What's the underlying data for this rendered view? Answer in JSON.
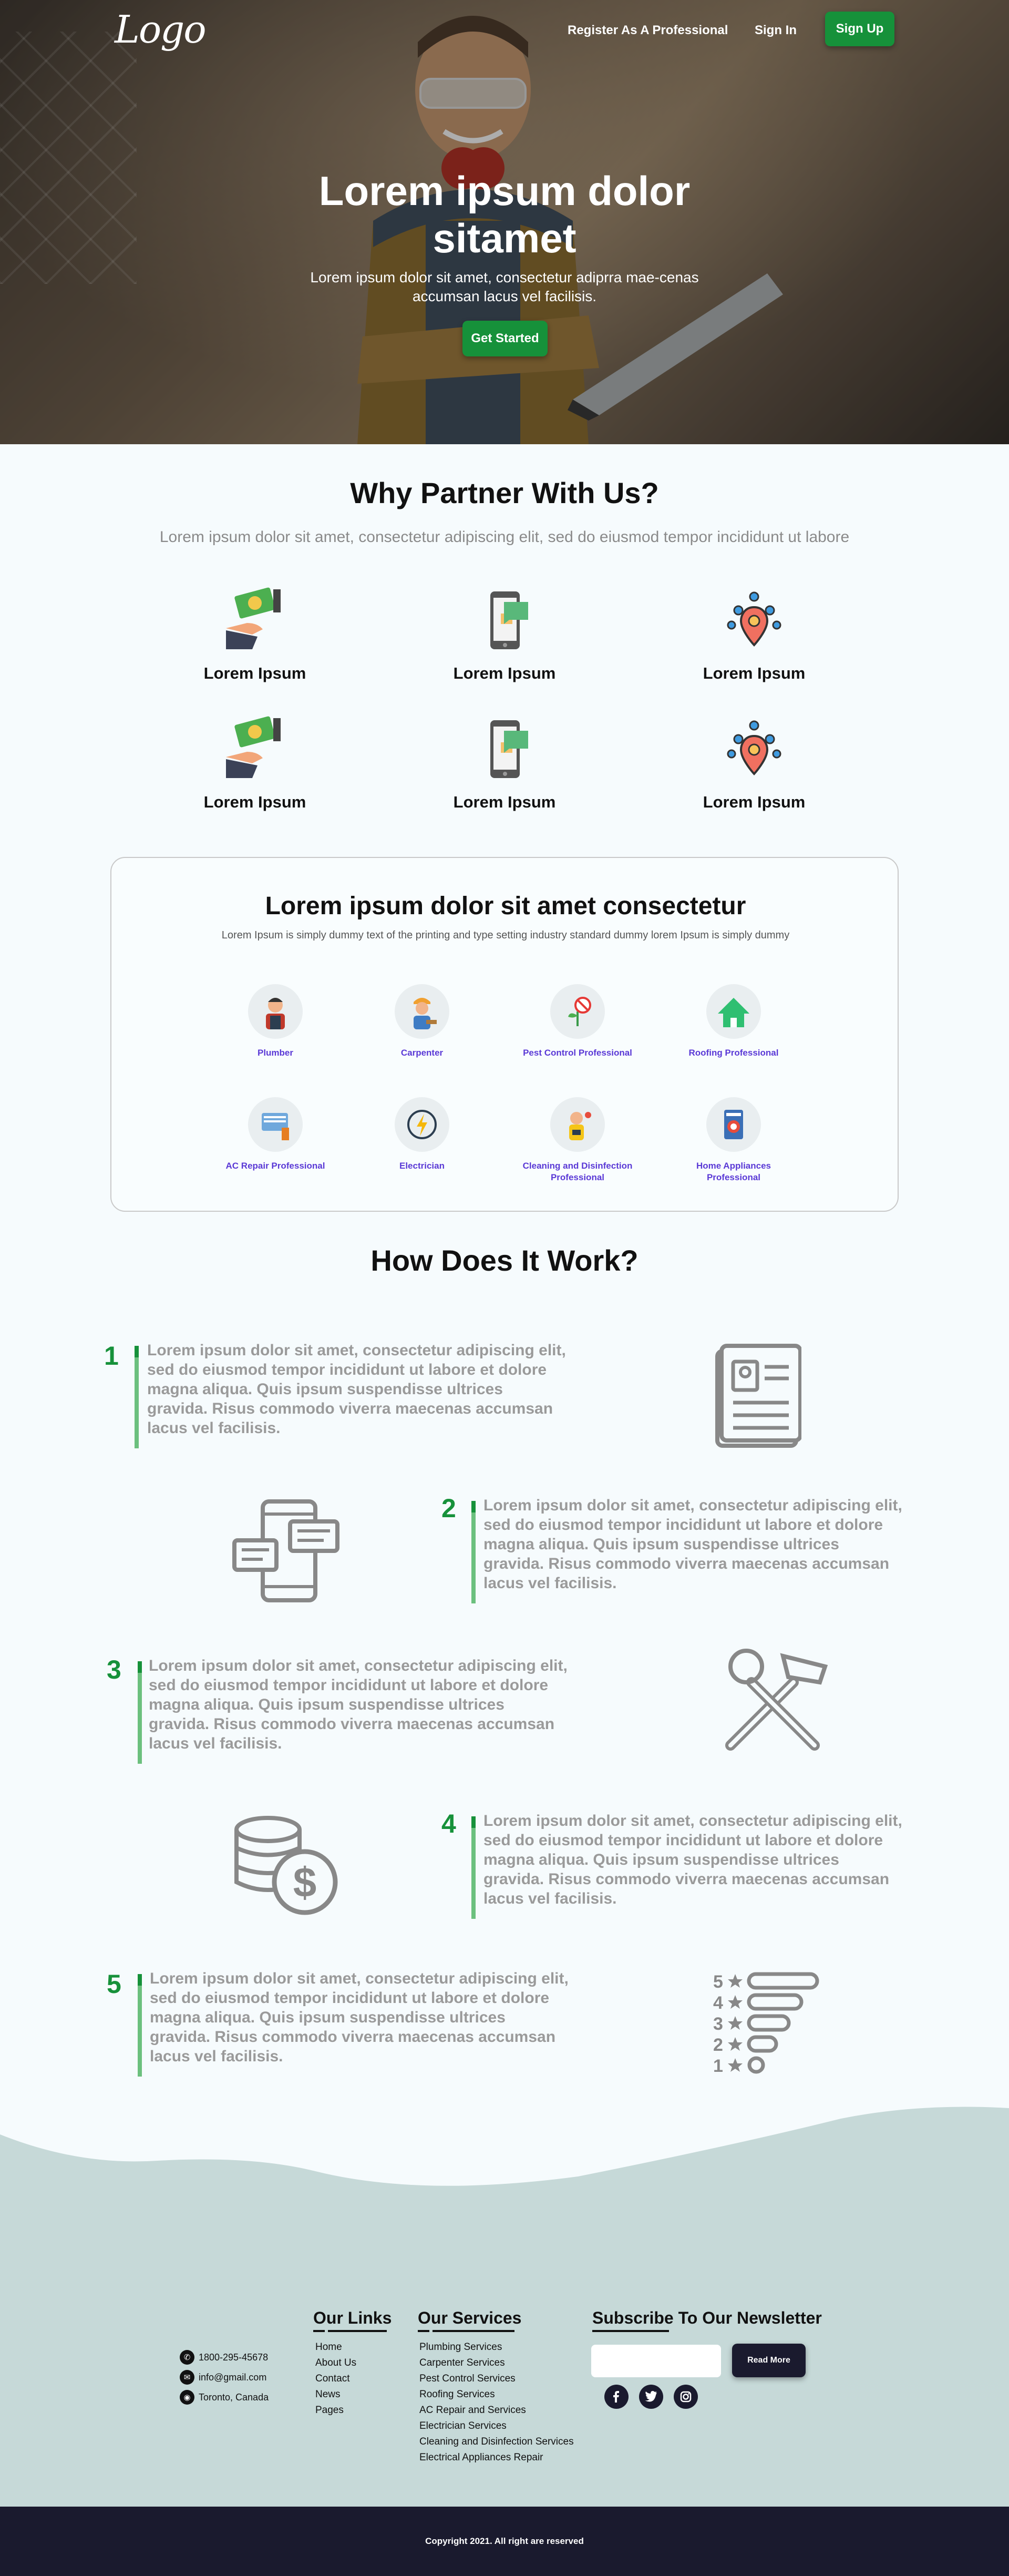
{
  "nav": {
    "logo": "Logo",
    "register": "Register As A Professional",
    "signin": "Sign In",
    "signup": "Sign Up"
  },
  "hero": {
    "title": "Lorem ipsum dolor sitamet",
    "subtitle": "Lorem ipsum dolor sit amet, consectetur adiprra mae-cenas accumsan lacus vel facilisis.",
    "cta": "Get Started"
  },
  "why": {
    "title": "Why Partner With Us?",
    "subtitle": "Lorem ipsum dolor sit amet, consectetur adipiscing elit, sed do eiusmod tempor incididunt ut labore",
    "features": [
      {
        "label": "Lorem Ipsum",
        "icon": "money-hand-icon"
      },
      {
        "label": "Lorem Ipsum",
        "icon": "phone-message-icon"
      },
      {
        "label": "Lorem Ipsum",
        "icon": "location-pin-icon"
      },
      {
        "label": "Lorem Ipsum",
        "icon": "money-hand-icon"
      },
      {
        "label": "Lorem Ipsum",
        "icon": "phone-message-icon"
      },
      {
        "label": "Lorem Ipsum",
        "icon": "location-pin-icon"
      }
    ]
  },
  "services_card": {
    "title": "Lorem ipsum dolor sit amet consectetur",
    "description": "Lorem Ipsum is simply dummy text of the printing and type setting industry standard dummy lorem Ipsum is simply dummy",
    "items": [
      {
        "label": "Plumber",
        "icon": "plumber-icon"
      },
      {
        "label": "Carpenter",
        "icon": "carpenter-icon"
      },
      {
        "label": "Pest Control Professional",
        "icon": "pest-control-icon"
      },
      {
        "label": "Roofing Professional",
        "icon": "roofing-icon"
      },
      {
        "label": "AC Repair Professional",
        "icon": "ac-repair-icon"
      },
      {
        "label": "Electrician",
        "icon": "electrician-icon"
      },
      {
        "label": "Cleaning and Disinfection Professional",
        "icon": "cleaning-icon"
      },
      {
        "label": "Home Appliances Professional",
        "icon": "home-appliances-icon"
      }
    ]
  },
  "how": {
    "title": "How Does It Work?",
    "steps": [
      {
        "number": "1",
        "text": "Lorem ipsum dolor sit amet, consectetur adipiscing elit, sed do eiusmod tempor incididunt ut labore et dolore magna aliqua. Quis ipsum suspendisse ultrices gravida. Risus commodo viverra maecenas accumsan lacus vel facilisis.",
        "icon": "document-profile-icon"
      },
      {
        "number": "2",
        "text": "Lorem ipsum dolor sit amet, consectetur adipiscing elit, sed do eiusmod tempor incididunt ut labore et dolore magna aliqua. Quis ipsum suspendisse ultrices gravida. Risus commodo viverra maecenas accumsan lacus vel facilisis.",
        "icon": "phone-chat-icon"
      },
      {
        "number": "3",
        "text": "Lorem ipsum dolor sit amet, consectetur adipiscing elit, sed do eiusmod tempor incididunt ut labore et dolore magna aliqua. Quis ipsum suspendisse ultrices gravida. Risus commodo viverra maecenas accumsan lacus vel facilisis.",
        "icon": "wrench-hammer-icon"
      },
      {
        "number": "4",
        "text": "Lorem ipsum dolor sit amet, consectetur adipiscing elit, sed do eiusmod tempor incididunt ut labore et dolore magna aliqua. Quis ipsum suspendisse ultrices gravida. Risus commodo viverra maecenas accumsan lacus vel facilisis.",
        "icon": "coins-dollar-icon"
      },
      {
        "number": "5",
        "text": "Lorem ipsum dolor sit amet, consectetur adipiscing elit, sed do eiusmod tempor incididunt ut labore et dolore magna aliqua. Quis ipsum suspendisse ultrices gravida. Risus commodo viverra maecenas accumsan lacus vel facilisis.",
        "icon": "rating-stars-icon"
      }
    ]
  },
  "footer": {
    "contact": {
      "phone": "1800-295-45678",
      "email": "info@gmail.com",
      "location": "Toronto, Canada"
    },
    "our_links": {
      "title": "Our Links",
      "items": [
        "Home",
        "About Us",
        "Contact",
        "News",
        "Pages"
      ]
    },
    "our_services": {
      "title": "Our Services",
      "items": [
        "Plumbing Services",
        "Carpenter Services",
        "Pest Control Services",
        "Roofing Services",
        "AC Repair and Services",
        "Electrician Services",
        "Cleaning and Disinfection Services",
        "Electrical Appliances Repair"
      ]
    },
    "newsletter": {
      "title": "Subscribe To Our Newsletter",
      "input_placeholder": "",
      "button": "Read More"
    },
    "social": [
      "facebook-icon",
      "twitter-icon",
      "instagram-icon"
    ],
    "copyright": "Copyright 2021. All right are reserved"
  },
  "colors": {
    "primary_green": "#16913a",
    "dark_navy": "#1a1a2e",
    "footer_bg": "#c6d9d8",
    "service_label": "#5a39d6"
  }
}
